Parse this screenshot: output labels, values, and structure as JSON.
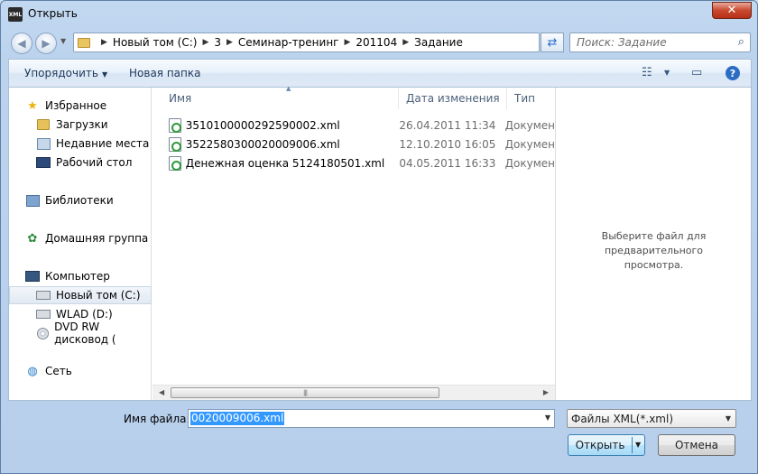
{
  "window": {
    "title": "Открыть",
    "app_icon_text": "XML",
    "close_glyph": "✕"
  },
  "address_bar": {
    "crumbs": [
      "Новый том (C:)",
      "3",
      "Семинар-тренинг",
      "201104",
      "Задание"
    ],
    "separator": "▶"
  },
  "search": {
    "placeholder": "Поиск: Задание"
  },
  "toolbar": {
    "organize_label": "Упорядочить",
    "new_folder_label": "Новая папка"
  },
  "sidebar": {
    "favorites": {
      "label": "Избранное",
      "items": [
        "Загрузки",
        "Недавние места",
        "Рабочий стол"
      ]
    },
    "libraries": {
      "label": "Библиотеки"
    },
    "homegroup": {
      "label": "Домашняя группа"
    },
    "computer": {
      "label": "Компьютер",
      "items": [
        "Новый том (C:)",
        "WLAD (D:)",
        "DVD RW дисковод ("
      ]
    },
    "network": {
      "label": "Сеть"
    },
    "selected": "Новый том (C:)"
  },
  "file_list": {
    "columns": [
      "Имя",
      "Дата изменения",
      "Тип"
    ],
    "rows": [
      {
        "name": "3510100000292590002.xml",
        "date": "26.04.2011 11:34",
        "type": "Докумен"
      },
      {
        "name": "3522580300020009006.xml",
        "date": "12.10.2010 16:05",
        "type": "Докумен"
      },
      {
        "name": "Денежная оценка 5124180501.xml",
        "date": "04.05.2011 16:33",
        "type": "Докумен"
      }
    ]
  },
  "preview": {
    "line1": "Выберите файл для предварительного",
    "line2": "просмотра."
  },
  "bottom": {
    "filename_label": "Имя файла:",
    "filename_value": "0020009006.xml",
    "filter_value": "Файлы XML(*.xml)",
    "open_label": "Открыть",
    "cancel_label": "Отмена"
  },
  "icons": {
    "back": "arrow-left-icon",
    "forward": "arrow-right-icon",
    "refresh": "refresh-icon",
    "search": "magnifier-icon",
    "help": "help-icon"
  }
}
